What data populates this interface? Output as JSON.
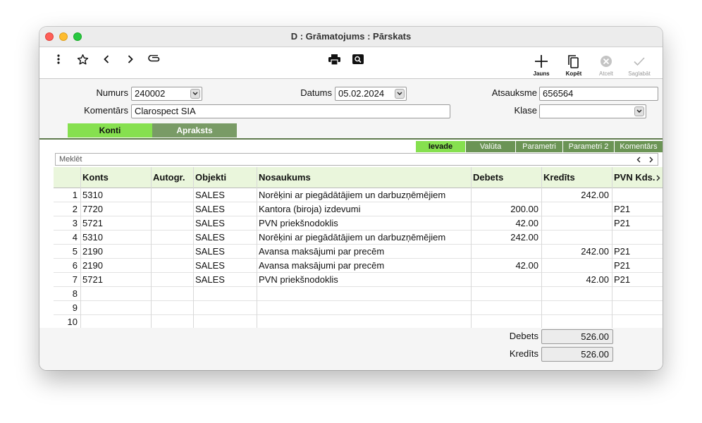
{
  "window": {
    "title": "D : Grāmatojums : Pārskats"
  },
  "toolbar": {
    "new_label": "Jauns",
    "copy_label": "Kopēt",
    "cancel_label": "Atcelt",
    "save_label": "Saglabāt"
  },
  "form": {
    "number_label": "Numurs",
    "number_value": "240002",
    "date_label": "Datums",
    "date_value": "05.02.2024",
    "reference_label": "Atsauksme",
    "reference_value": "656564",
    "comment_label": "Komentārs",
    "comment_value": "Clarospect SIA",
    "class_label": "Klase",
    "class_value": ""
  },
  "tabs": [
    {
      "label": "Konti",
      "active": true
    },
    {
      "label": "Apraksts",
      "active": false
    }
  ],
  "subtabs": [
    {
      "label": "Ievade",
      "active": true
    },
    {
      "label": "Valūta"
    },
    {
      "label": "Parametri"
    },
    {
      "label": "Parametri 2"
    },
    {
      "label": "Komentārs"
    }
  ],
  "search": {
    "placeholder": "Meklēt"
  },
  "table": {
    "columns": [
      "Konts",
      "Autogr.",
      "Objekti",
      "Nosaukums",
      "Debets",
      "Kredīts",
      "PVN Kds."
    ],
    "rows": [
      {
        "n": "1",
        "konts": "5310",
        "autogr": "",
        "objekti": "SALES",
        "nosaukums": "Norēķini ar piegādātājiem un darbuzņēmējiem",
        "debets": "",
        "kredits": "242.00",
        "pvn": ""
      },
      {
        "n": "2",
        "konts": "7720",
        "autogr": "",
        "objekti": "SALES",
        "nosaukums": "Kantora (biroja) izdevumi",
        "debets": "200.00",
        "kredits": "",
        "pvn": "P21"
      },
      {
        "n": "3",
        "konts": "5721",
        "autogr": "",
        "objekti": "SALES",
        "nosaukums": "PVN priekšnodoklis",
        "debets": "42.00",
        "kredits": "",
        "pvn": "P21"
      },
      {
        "n": "4",
        "konts": "5310",
        "autogr": "",
        "objekti": "SALES",
        "nosaukums": "Norēķini ar piegādātājiem un darbuzņēmējiem",
        "debets": "242.00",
        "kredits": "",
        "pvn": ""
      },
      {
        "n": "5",
        "konts": "2190",
        "autogr": "",
        "objekti": "SALES",
        "nosaukums": "Avansa maksājumi par precēm",
        "debets": "",
        "kredits": "242.00",
        "pvn": "P21"
      },
      {
        "n": "6",
        "konts": "2190",
        "autogr": "",
        "objekti": "SALES",
        "nosaukums": "Avansa maksājumi par precēm",
        "debets": "42.00",
        "kredits": "",
        "pvn": "P21"
      },
      {
        "n": "7",
        "konts": "5721",
        "autogr": "",
        "objekti": "SALES",
        "nosaukums": "PVN priekšnodoklis",
        "debets": "",
        "kredits": "42.00",
        "pvn": "P21"
      },
      {
        "n": "8",
        "konts": "",
        "autogr": "",
        "objekti": "",
        "nosaukums": "",
        "debets": "",
        "kredits": "",
        "pvn": ""
      },
      {
        "n": "9",
        "konts": "",
        "autogr": "",
        "objekti": "",
        "nosaukums": "",
        "debets": "",
        "kredits": "",
        "pvn": ""
      },
      {
        "n": "10",
        "konts": "",
        "autogr": "",
        "objekti": "",
        "nosaukums": "",
        "debets": "",
        "kredits": "",
        "pvn": ""
      }
    ]
  },
  "totals": {
    "debit_label": "Debets",
    "debit_value": "526.00",
    "credit_label": "Kredīts",
    "credit_value": "526.00"
  },
  "colors": {
    "tab_active": "#86e04f",
    "tab_inactive": "#799b66",
    "subtab_active": "#86e04f",
    "subtab_inactive": "#6b9455",
    "header_bg": "#eaf6dc"
  }
}
